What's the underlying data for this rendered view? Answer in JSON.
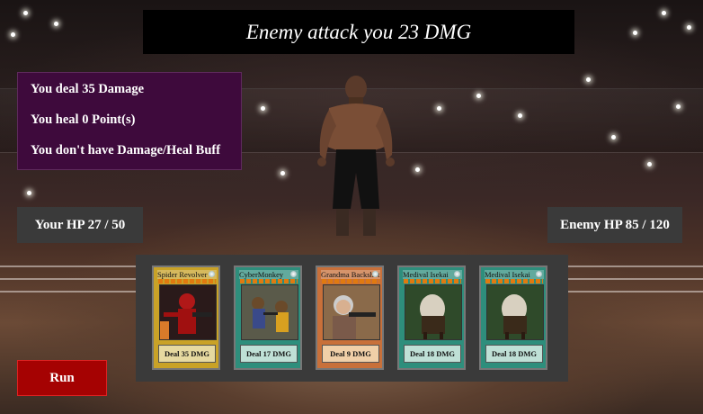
{
  "banner": {
    "text": "Enemy attack you 23 DMG"
  },
  "combat_log": {
    "damage_dealt": "You deal 35 Damage",
    "heal": "You heal 0 Point(s)",
    "buff": "You don't have Damage/Heal Buff"
  },
  "player_hp": {
    "text": "Your HP 27 / 50"
  },
  "enemy_hp": {
    "text": "Enemy HP 85 / 120"
  },
  "hand": {
    "cards": [
      {
        "name": "Spider Revolver",
        "effect": "Deal 35 DMG",
        "frame_color": "#c9a227",
        "desc_color": "#e6d9a0",
        "icon": "spider-gunman-art"
      },
      {
        "name": "CyberMonkey",
        "effect": "Deal 17 DMG",
        "frame_color": "#2e8e7c",
        "desc_color": "#bfe0d6",
        "icon": "monkeys-fighting-art"
      },
      {
        "name": "Grandma Backshot",
        "effect": "Deal 9 DMG",
        "frame_color": "#c8703a",
        "desc_color": "#f0cfa8",
        "icon": "grandma-gun-art"
      },
      {
        "name": "Medival Isekai",
        "effect": "Deal 18 DMG",
        "frame_color": "#2e8e7c",
        "desc_color": "#bfe0d6",
        "icon": "horse-art"
      },
      {
        "name": "Medival Isekai",
        "effect": "Deal 18 DMG",
        "frame_color": "#2e8e7c",
        "desc_color": "#bfe0d6",
        "icon": "horse-art"
      }
    ]
  },
  "run_button": {
    "label": "Run"
  }
}
